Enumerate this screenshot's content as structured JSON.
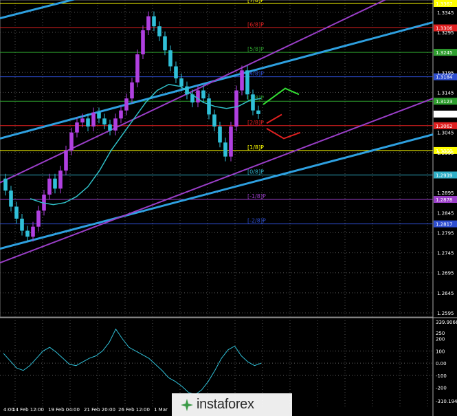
{
  "chart_data": {
    "type": "line",
    "symbol_price": "1.3091",
    "price_axis": {
      "ylim": [
        1.2595,
        1.3367
      ],
      "ticks": [
        "1.3345",
        "1.3295",
        "1.3195",
        "1.3145",
        "1.3045",
        "1.2995",
        "1.2895",
        "1.2845",
        "1.2795",
        "1.2745",
        "1.2695",
        "1.2645",
        "1.2595"
      ]
    },
    "x_ticks": [
      "4:00",
      "14 Feb 12:00",
      "19 Feb 04:00",
      "21 Feb 20:00",
      "26 Feb 12:00",
      "1 Mar"
    ],
    "murray_levels": [
      {
        "label": "[7/8]P",
        "value": 1.3367,
        "price": "1.3367",
        "color": "#ffff00"
      },
      {
        "label": "[6/8]P",
        "value": 1.3306,
        "price": "1.3306",
        "color": "#e02020"
      },
      {
        "label": "[5/8]P",
        "value": 1.3245,
        "price": "1.3245",
        "color": "#2e9e2e"
      },
      {
        "label": "[4/8]P",
        "value": 1.3184,
        "price": "1.3184",
        "color": "#2e4ed0"
      },
      {
        "label": "[3/8]P",
        "value": 1.3123,
        "price": "1.3123",
        "color": "#2e9e2e"
      },
      {
        "label": "[2/8]P",
        "value": 1.3062,
        "price": "1.3062",
        "color": "#e02020"
      },
      {
        "label": "[1/8]P",
        "value": 1.3,
        "price": "1.3000",
        "color": "#ffff00"
      },
      {
        "label": "[0/8]P",
        "value": 1.2939,
        "price": "1.2939",
        "color": "#30b0c8"
      },
      {
        "label": "[-1/8]P",
        "value": 1.2878,
        "price": "1.2878",
        "color": "#9a3ec8"
      },
      {
        "label": "[-2/8]P",
        "value": 1.2817,
        "price": "1.2817",
        "color": "#2e4ed0"
      }
    ],
    "candles": [
      [
        1.293,
        1.29
      ],
      [
        1.29,
        1.286
      ],
      [
        1.286,
        1.283
      ],
      [
        1.283,
        1.28
      ],
      [
        1.28,
        1.2785
      ],
      [
        1.2785,
        1.281
      ],
      [
        1.281,
        1.285
      ],
      [
        1.285,
        1.289
      ],
      [
        1.289,
        1.293
      ],
      [
        1.293,
        1.2905
      ],
      [
        1.2905,
        1.295
      ],
      [
        1.295,
        1.3
      ],
      [
        1.3,
        1.3045
      ],
      [
        1.3045,
        1.307
      ],
      [
        1.307,
        1.308
      ],
      [
        1.308,
        1.306
      ],
      [
        1.306,
        1.3095
      ],
      [
        1.3095,
        1.308
      ],
      [
        1.308,
        1.3065
      ],
      [
        1.3065,
        1.305
      ],
      [
        1.305,
        1.308
      ],
      [
        1.308,
        1.31
      ],
      [
        1.31,
        1.313
      ],
      [
        1.313,
        1.317
      ],
      [
        1.317,
        1.324
      ],
      [
        1.324,
        1.33
      ],
      [
        1.33,
        1.3335
      ],
      [
        1.3335,
        1.331
      ],
      [
        1.331,
        1.3285
      ],
      [
        1.3285,
        1.325
      ],
      [
        1.325,
        1.321
      ],
      [
        1.321,
        1.318
      ],
      [
        1.318,
        1.316
      ],
      [
        1.316,
        1.314
      ],
      [
        1.314,
        1.312
      ],
      [
        1.312,
        1.315
      ],
      [
        1.315,
        1.313
      ],
      [
        1.313,
        1.309
      ],
      [
        1.309,
        1.306
      ],
      [
        1.306,
        1.302
      ],
      [
        1.302,
        1.2985
      ],
      [
        1.2985,
        1.306
      ],
      [
        1.306,
        1.315
      ],
      [
        1.315,
        1.32
      ],
      [
        1.32,
        1.314
      ],
      [
        1.314,
        1.31
      ],
      [
        1.31,
        1.3091
      ]
    ],
    "sma": [
      1.288,
      1.287,
      1.2865,
      1.287,
      1.2885,
      1.291,
      1.295,
      1.3,
      1.304,
      1.308,
      1.312,
      1.315,
      1.3165,
      1.316,
      1.314,
      1.312,
      1.311,
      1.3105,
      1.311,
      1.3125,
      1.313
    ],
    "channel_lines": [
      {
        "color": "#2ea0e0",
        "p1": [
          0,
          1.333
        ],
        "p2": [
          160,
          1.34
        ]
      },
      {
        "color": "#2ea0e0",
        "p1": [
          0,
          1.303
        ],
        "p2": [
          630,
          1.332
        ]
      },
      {
        "color": "#2ea0e0",
        "p1": [
          0,
          1.2755
        ],
        "p2": [
          630,
          1.304
        ]
      },
      {
        "color": "#9a3ec8",
        "p1": [
          0,
          1.292
        ],
        "p2": [
          590,
          1.34
        ]
      },
      {
        "color": "#9a3ec8",
        "p1": [
          0,
          1.272
        ],
        "p2": [
          630,
          1.313
        ]
      }
    ],
    "forecast_arrows": [
      {
        "color": "#33dd33",
        "points": [
          [
            383,
            1.3115
          ],
          [
            415,
            1.3155
          ],
          [
            435,
            1.314
          ]
        ]
      },
      {
        "color": "#e02020",
        "points": [
          [
            388,
            1.3068
          ],
          [
            410,
            1.309
          ]
        ]
      },
      {
        "color": "#e02020",
        "points": [
          [
            388,
            1.3055
          ],
          [
            413,
            1.303
          ],
          [
            437,
            1.3045
          ]
        ]
      }
    ],
    "cci": {
      "ylim": [
        -310.194,
        339.9066
      ],
      "ticks": [
        "339.9066",
        "250",
        "200",
        "100",
        "0.00",
        "-100",
        "-200",
        "-310.194"
      ],
      "values": [
        80,
        20,
        -40,
        -60,
        -20,
        40,
        100,
        130,
        90,
        40,
        -10,
        -20,
        10,
        40,
        60,
        100,
        170,
        280,
        200,
        130,
        100,
        70,
        40,
        -10,
        -60,
        -120,
        -150,
        -190,
        -240,
        -260,
        -220,
        -150,
        -60,
        40,
        110,
        140,
        60,
        10,
        -20,
        0
      ]
    }
  }
}
